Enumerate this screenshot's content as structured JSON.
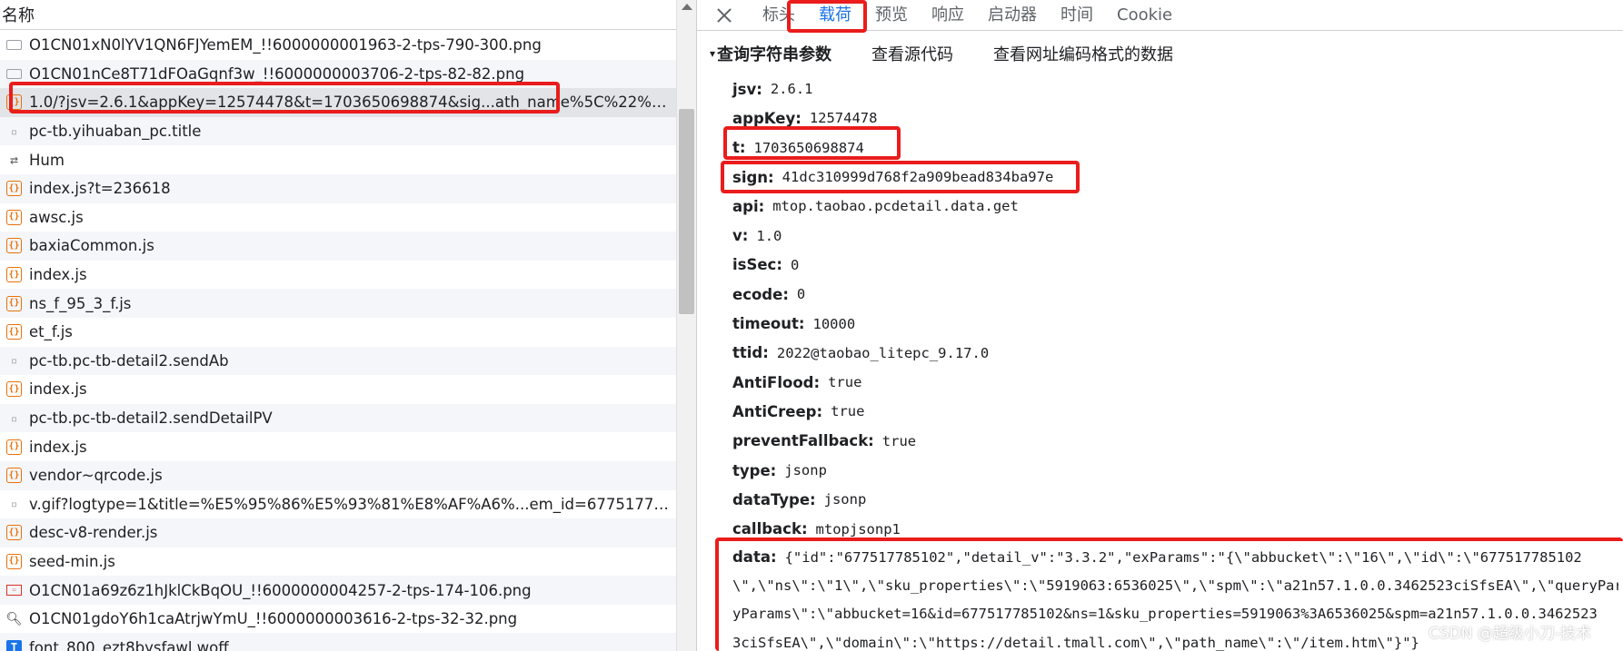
{
  "list": {
    "header": "名称",
    "items": [
      {
        "name": "O1CN01xN0lYV1QN6FJYemEM_!!6000000001963-2-tps-790-300.png",
        "icon": "image-file-icon"
      },
      {
        "name": "O1CN01nCe8T71dFOaGqnf3w_!!6000000003706-2-tps-82-82.png",
        "icon": "image-file-icon"
      },
      {
        "name": "1.0/?jsv=2.6.1&appKey=12574478&t=1703650698874&sig...ath_name%5C%22%3A%5...",
        "icon": "script-file-icon"
      },
      {
        "name": "pc-tb.yihuaban_pc.title",
        "icon": "document-file-icon"
      },
      {
        "name": "Hum",
        "icon": "websocket-icon"
      },
      {
        "name": "index.js?t=236618",
        "icon": "script-file-icon"
      },
      {
        "name": "awsc.js",
        "icon": "script-file-icon"
      },
      {
        "name": "baxiaCommon.js",
        "icon": "script-file-icon"
      },
      {
        "name": "index.js",
        "icon": "script-file-icon"
      },
      {
        "name": "ns_f_95_3_f.js",
        "icon": "script-file-icon"
      },
      {
        "name": "et_f.js",
        "icon": "script-file-icon"
      },
      {
        "name": "pc-tb.pc-tb-detail2.sendAb",
        "icon": "document-file-icon"
      },
      {
        "name": "index.js",
        "icon": "script-file-icon"
      },
      {
        "name": "pc-tb.pc-tb-detail2.sendDetailPV",
        "icon": "document-file-icon"
      },
      {
        "name": "index.js",
        "icon": "script-file-icon"
      },
      {
        "name": "vendor~qrcode.js",
        "icon": "script-file-icon"
      },
      {
        "name": "v.gif?logtype=1&title=%E5%95%86%E5%93%81%E8%AF%A6%...em_id=677517785102...",
        "icon": "document-file-icon"
      },
      {
        "name": "desc-v8-render.js",
        "icon": "script-file-icon"
      },
      {
        "name": "seed-min.js",
        "icon": "script-file-icon"
      },
      {
        "name": "O1CN01a69z6z1hJklCkBqOU_!!6000000004257-2-tps-174-106.png",
        "icon": "png-thumbnail-icon"
      },
      {
        "name": "O1CN01gdoY6h1caAtrjwYmU_!!6000000003616-2-tps-32-32.png",
        "icon": "search-thumbnail-icon"
      },
      {
        "name": "font_800_ezt8bysfawl.woff",
        "icon": "font-file-icon"
      }
    ]
  },
  "tabs": {
    "close_glyph": "",
    "items": [
      "标头",
      "载荷",
      "预览",
      "响应",
      "启动器",
      "时间",
      "Cookie"
    ],
    "active_index": 1
  },
  "section": {
    "toggle": "▾",
    "title": "查询字符串参数",
    "view_source": "查看源代码",
    "view_url_encoded": "查看网址编码格式的数据"
  },
  "params": [
    {
      "key": "jsv",
      "value": "2.6.1"
    },
    {
      "key": "appKey",
      "value": "12574478"
    },
    {
      "key": "t",
      "value": "1703650698874"
    },
    {
      "key": "sign",
      "value": "41dc310999d768f2a909bead834ba97e"
    },
    {
      "key": "api",
      "value": "mtop.taobao.pcdetail.data.get"
    },
    {
      "key": "v",
      "value": "1.0"
    },
    {
      "key": "isSec",
      "value": "0"
    },
    {
      "key": "ecode",
      "value": "0"
    },
    {
      "key": "timeout",
      "value": "10000"
    },
    {
      "key": "ttid",
      "value": "2022@taobao_litepc_9.17.0"
    },
    {
      "key": "AntiFlood",
      "value": "true"
    },
    {
      "key": "AntiCreep",
      "value": "true"
    },
    {
      "key": "preventFallback",
      "value": "true"
    },
    {
      "key": "type",
      "value": "jsonp"
    },
    {
      "key": "dataType",
      "value": "jsonp"
    },
    {
      "key": "callback",
      "value": "mtopjsonp1"
    }
  ],
  "data_param": {
    "key": "data",
    "lines": [
      "{\"id\":\"677517785102\",\"detail_v\":\"3.3.2\",\"exParams\":\"{\\\"abbucket\\\":\\\"16\\\",\\\"id\\\":\\\"677517785102",
      "\\\",\\\"ns\\\":\\\"1\\\",\\\"sku_properties\\\":\\\"5919063:6536025\\\",\\\"spm\\\":\\\"a21n57.1.0.0.3462523ciSfsEA\\\",\\\"queryParams",
      "yParams\\\":\\\"abbucket=16&id=677517785102&ns=1&sku_properties=5919063%3A6536025&spm=a21n57.1.0.0.3462523",
      "3ciSfsEA\\\",\\\"domain\\\":\\\"https://detail.tmall.com\\\",\\\"path_name\\\":\\\"/item.htm\\\"}\"}"
    ]
  },
  "watermark": "CSDN @超级小刀-技术"
}
